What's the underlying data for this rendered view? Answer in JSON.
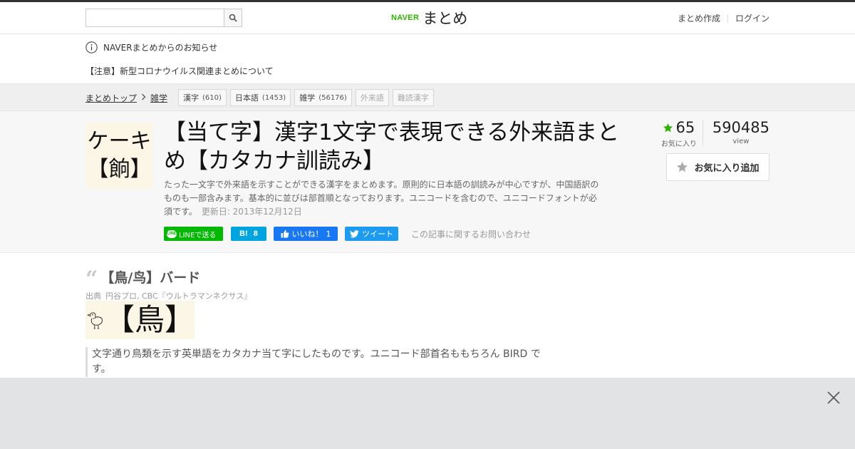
{
  "header": {
    "search_placeholder": "",
    "logo_brand": "NAVER",
    "logo_name": "まとめ",
    "create_link": "まとめ作成",
    "login_link": "ログイン"
  },
  "notice": {
    "heading": "NAVERまとめからのお知らせ",
    "link": "【注意】新型コロナウイルス関連まとめについて"
  },
  "breadcrumb": {
    "items": [
      "まとめトップ",
      "雑学"
    ],
    "tags": [
      {
        "label": "漢字",
        "count": "(610)"
      },
      {
        "label": "日本語",
        "count": "(1453)"
      },
      {
        "label": "雑学",
        "count": "(56176)"
      },
      {
        "label": "外来語",
        "count": ""
      },
      {
        "label": "難読漢字",
        "count": ""
      }
    ]
  },
  "article": {
    "thumb_top": "ケーキ",
    "thumb_bottom": "【餉】",
    "title": "【当て字】漢字1文字で表現できる外来語まとめ【カタカナ訓読み】",
    "description": "たった一文字で外来語を示すことができる漢字をまとめます。原則的に日本語の訓読みが中心ですが、中国語訳のものも一部含みます。基本的に並びは部首順となっております。ユニコードを含むので、ユニコードフォントが必須です。",
    "updated": "更新日: 2013年12月12日",
    "favorites": "65",
    "favorites_label": "お気に入り",
    "views": "590485",
    "views_label": "view",
    "fav_button": "お気に入り追加",
    "share": {
      "line": "LINEで送る",
      "line_icon": "LINE",
      "hatena_icon": "B!",
      "hatena_count": "8",
      "fb_label": "いいね！",
      "fb_count": "1",
      "tweet": "ツイート"
    },
    "inquiry": "この記事に関するお問い合わせ"
  },
  "section": {
    "heading": "【鳥/鸟】バード",
    "source_label": "出典",
    "source": "円谷プロ, CBC『ウルトラマンネクサス』",
    "image_text": "【鳥】",
    "body": "文字通り鳥類を示す英単語をカタカナ当て字にしたものです。ユニコード部首名ももちろん BIRD です。"
  },
  "colors": {
    "naver_green": "#2db400",
    "star": "#2db400",
    "line": "#00b900",
    "hatena": "#00a4de",
    "facebook": "#1877f2",
    "twitter": "#1d9bf0"
  }
}
